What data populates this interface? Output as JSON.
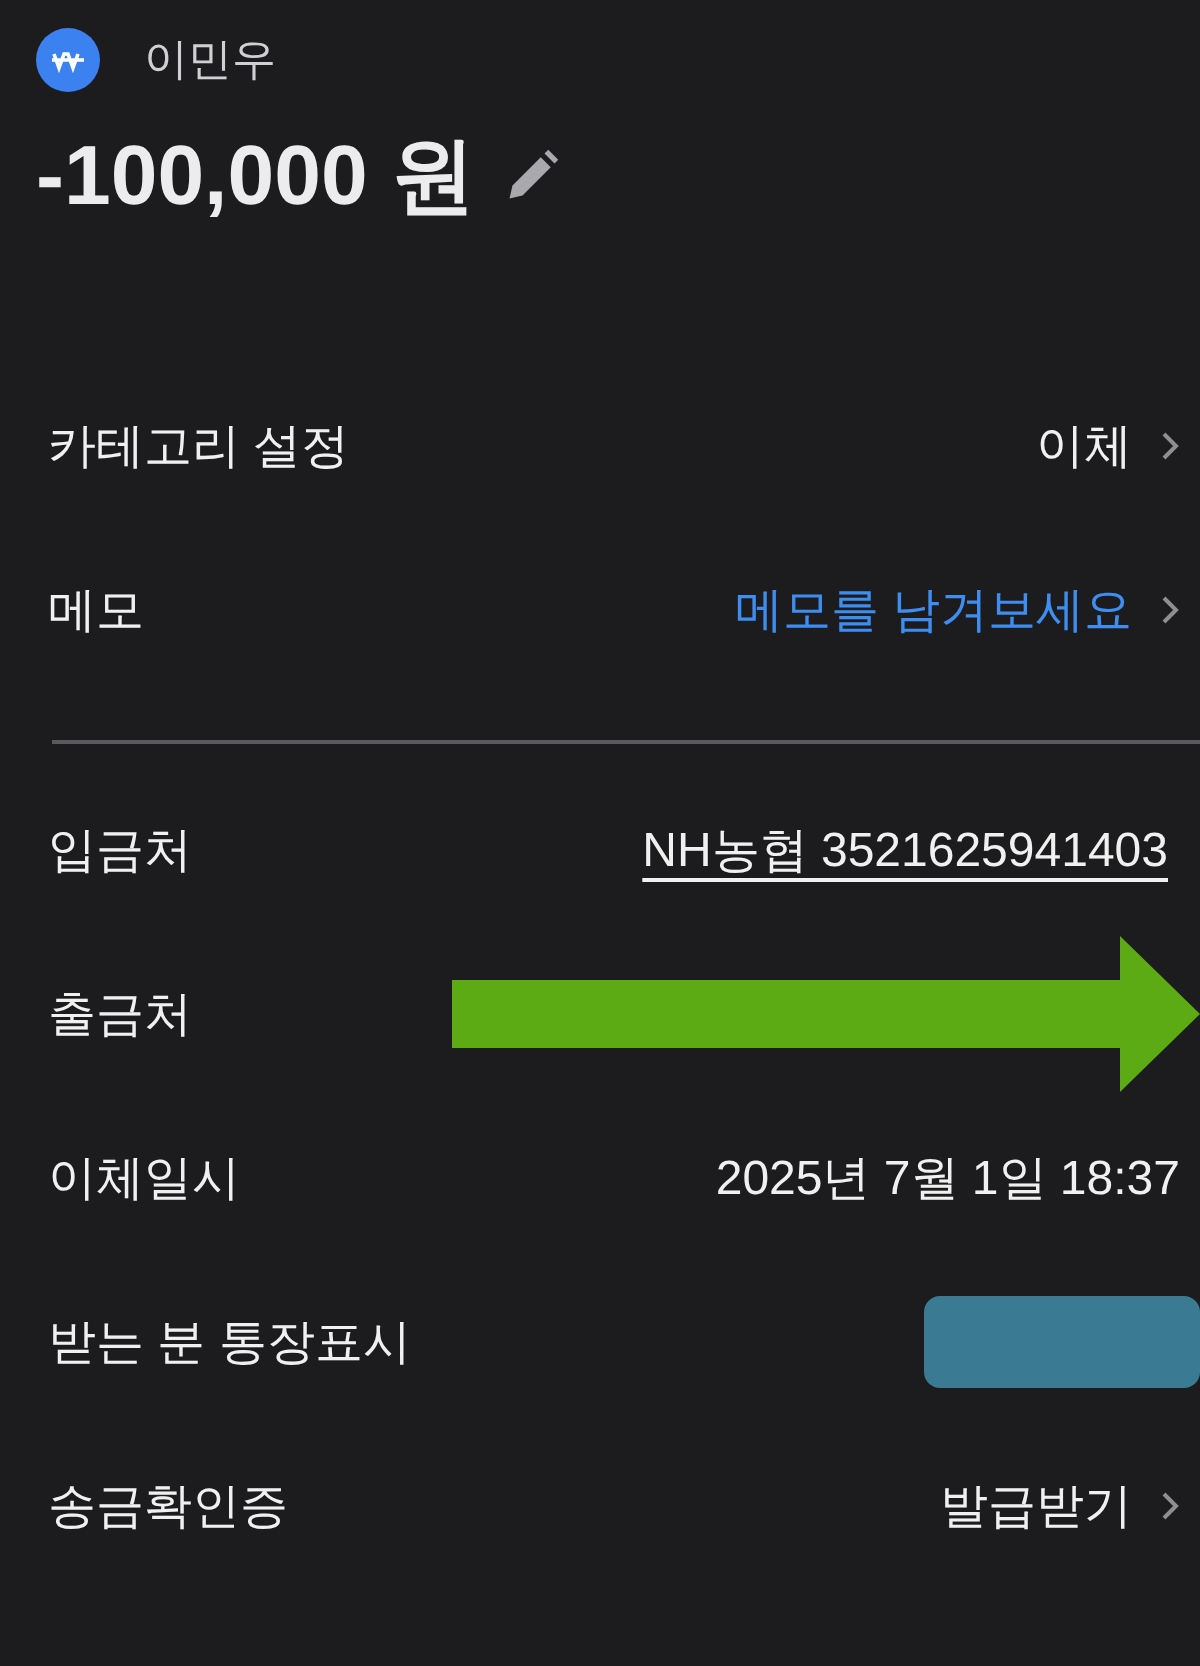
{
  "header": {
    "name": "이민우",
    "amount": "-100,000 원"
  },
  "sections": [
    {
      "rows": [
        {
          "label": "카테고리 설정",
          "kind": "value",
          "value": "이체",
          "chevron": true
        },
        {
          "label": "메모",
          "kind": "link",
          "value": "메모를 남겨보세요",
          "chevron": true
        }
      ]
    },
    {
      "rows": [
        {
          "label": "입금처",
          "kind": "account",
          "value": "NH농협 3521625941403",
          "chevron": false
        },
        {
          "label": "출금처",
          "kind": "arrow",
          "chevron": false
        },
        {
          "label": "이체일시",
          "kind": "value",
          "value": "2025년 7월 1일 18:37",
          "chevron": false
        },
        {
          "label": "받는 분 통장표시",
          "kind": "redacted",
          "chevron": false
        },
        {
          "label": "송금확인증",
          "kind": "value",
          "value": "발급받기",
          "chevron": true
        }
      ]
    }
  ]
}
